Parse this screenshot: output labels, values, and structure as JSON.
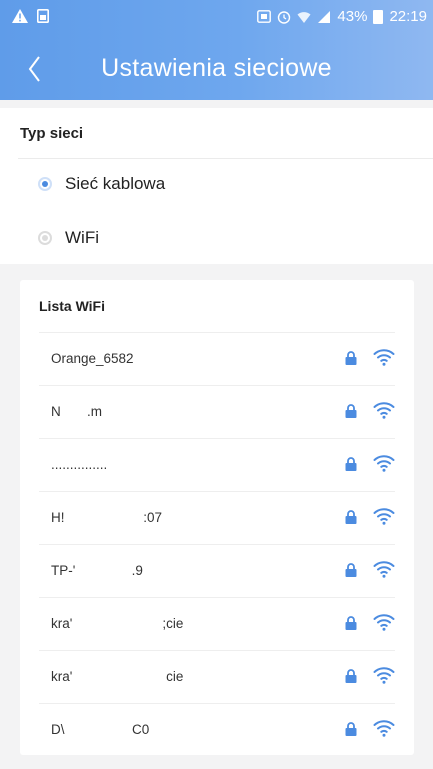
{
  "status_bar": {
    "battery": "43%",
    "time": "22:19",
    "left_icons": [
      "warning-icon",
      "gallery-icon"
    ],
    "right_icons": [
      "nfc-icon",
      "alarm-icon",
      "wifi-signal-icon",
      "cell-signal-icon",
      "battery-icon"
    ]
  },
  "header": {
    "title": "Ustawienia sieciowe",
    "back_icon": "chevron-left-icon",
    "gradient_start": "#5f9ce9",
    "gradient_end": "#8fb8f1"
  },
  "network_type": {
    "label": "Typ sieci",
    "options": [
      {
        "label": "Sieć kablowa",
        "selected": true
      },
      {
        "label": "WiFi",
        "selected": false
      }
    ],
    "accent_color": "#4b8be0"
  },
  "wifi_list": {
    "title": "Lista WiFi",
    "networks": [
      {
        "name": "Orange_6582"
      },
      {
        "name": "N       .m"
      },
      {
        "name": "..............."
      },
      {
        "name": "H!                     :07"
      },
      {
        "name": "TP-'               .9"
      },
      {
        "name": "kra'                        ;cie"
      },
      {
        "name": "kra'                         cie"
      },
      {
        "name": "D\\                  C0"
      }
    ],
    "lock_icon": "lock-icon",
    "signal_icon": "wifi-icon",
    "icon_color": "#4b8be0"
  }
}
